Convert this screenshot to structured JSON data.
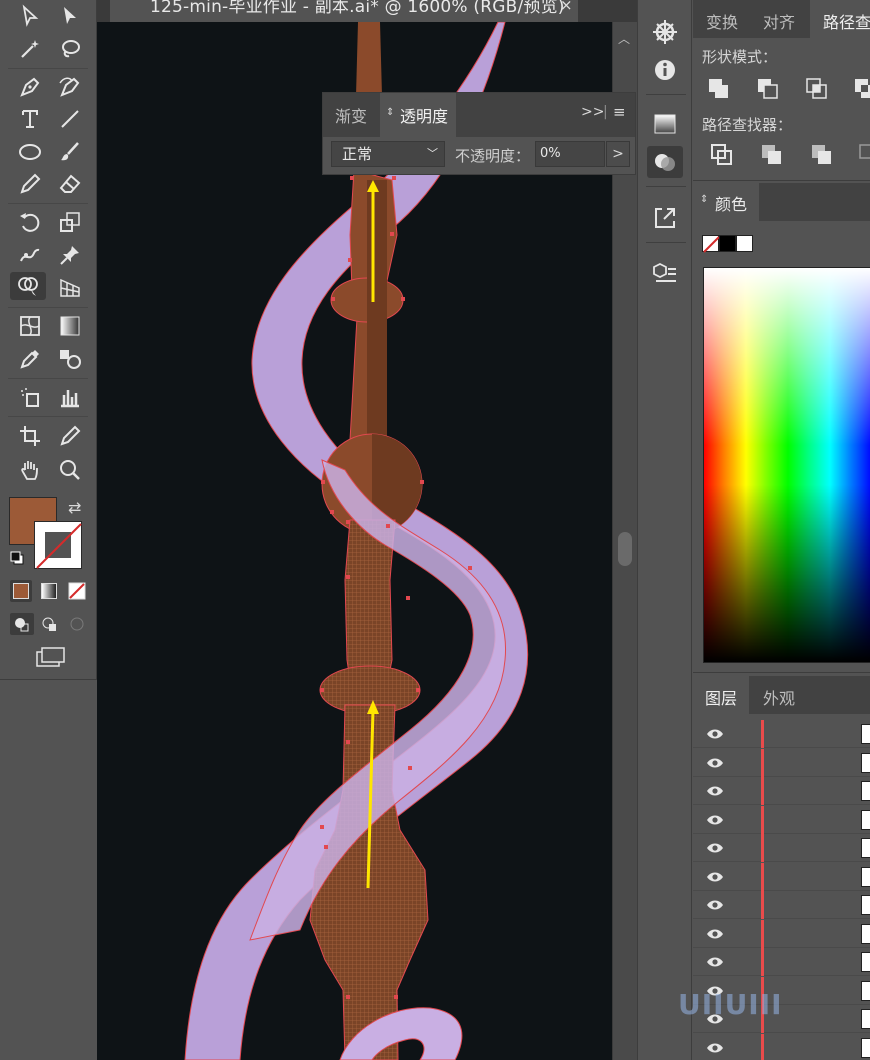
{
  "document": {
    "tab_title": "125-min-毕业作业 - 副本.ai* @ 1600% (RGB/预览)",
    "close_glyph": "×"
  },
  "transparency_panel": {
    "tabs": [
      "渐变",
      "透明度"
    ],
    "active_tab": "透明度",
    "blend_mode": "正常",
    "opacity_label": "不透明度：",
    "opacity_value": "0%",
    "expand_glyph": ">>",
    "more_glyph": ">"
  },
  "pathfinder_panel": {
    "tabs": [
      "变换",
      "对齐",
      "路径查"
    ],
    "active_tab": "路径查",
    "shape_modes_label": "形状模式：",
    "pathfinders_label": "路径查找器："
  },
  "color_panel": {
    "title": "颜色"
  },
  "layers_panel": {
    "tabs": [
      "图层",
      "外观"
    ],
    "active_tab": "图层",
    "row_count": 12
  },
  "toolbar": {
    "fill_color": "#9c5a37",
    "stroke_color": "none",
    "active_tool": "shape-builder-tool",
    "tools": [
      "selection-tool",
      "direct-selection-tool",
      "magic-wand-tool",
      "lasso-tool",
      "pen-tool",
      "curvature-tool",
      "type-tool",
      "line-tool",
      "ellipse-tool",
      "paintbrush-tool",
      "pencil-tool",
      "eraser-tool",
      "rotate-tool",
      "scale-tool",
      "puppet-warp-tool",
      "pin-tool",
      "shape-builder-tool",
      "perspective-grid-tool",
      "mesh-tool",
      "gradient-tool",
      "eyedropper-tool",
      "blend-tool",
      "symbol-sprayer-tool",
      "column-graph-tool",
      "artboard-tool",
      "slice-tool",
      "hand-tool",
      "zoom-tool"
    ]
  },
  "icon_strip": [
    "navigator-icon",
    "info-icon",
    "gradient-panel-icon",
    "transparency-panel-icon",
    "export-icon",
    "3d-materials-icon"
  ],
  "artwork": {
    "staff_color": "#8b4a2b",
    "ribbon_color": "#b9a0d8",
    "guide_arrow_color": "#ffe600",
    "selection_color": "#e2484f"
  },
  "watermark": "UIIUIII"
}
